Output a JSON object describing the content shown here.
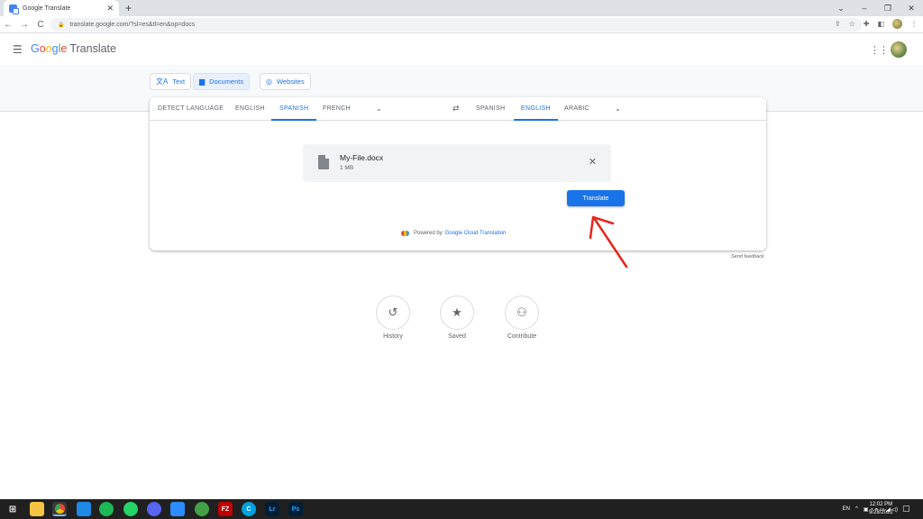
{
  "browser": {
    "tab_title": "Google Translate",
    "tab_close": "✕",
    "new_tab": "+",
    "url": "translate.google.com/?sl=es&tl=en&op=docs",
    "back": "←",
    "forward": "→",
    "reload": "C",
    "window_controls": [
      "⌄",
      "–",
      "❐",
      "✕"
    ]
  },
  "header": {
    "logo_text": "Google",
    "product": "Translate"
  },
  "modes": [
    {
      "label": "Text",
      "icon": "translate-icon"
    },
    {
      "label": "Documents",
      "icon": "document-icon",
      "active": true
    },
    {
      "label": "Websites",
      "icon": "globe-icon"
    }
  ],
  "source_languages": [
    "DETECT LANGUAGE",
    "ENGLISH",
    "SPANISH",
    "FRENCH"
  ],
  "source_active": "SPANISH",
  "target_languages": [
    "SPANISH",
    "ENGLISH",
    "ARABIC"
  ],
  "target_active": "ENGLISH",
  "file": {
    "name": "My-File.docx",
    "size": "1 MB"
  },
  "translate_button": "Translate",
  "powered_by": "Powered by",
  "powered_link": "Google Cloud Translation",
  "send_feedback": "Send feedback",
  "actions": [
    {
      "label": "History",
      "icon": "history-icon"
    },
    {
      "label": "Saved",
      "icon": "star-icon"
    },
    {
      "label": "Contribute",
      "icon": "people-icon"
    }
  ],
  "taskbar": {
    "language": "EN",
    "time": "12:02 PM",
    "date": "9/28/2022"
  },
  "colors": {
    "accent": "#1a73e8",
    "annotation_arrow": "#e8261c"
  }
}
